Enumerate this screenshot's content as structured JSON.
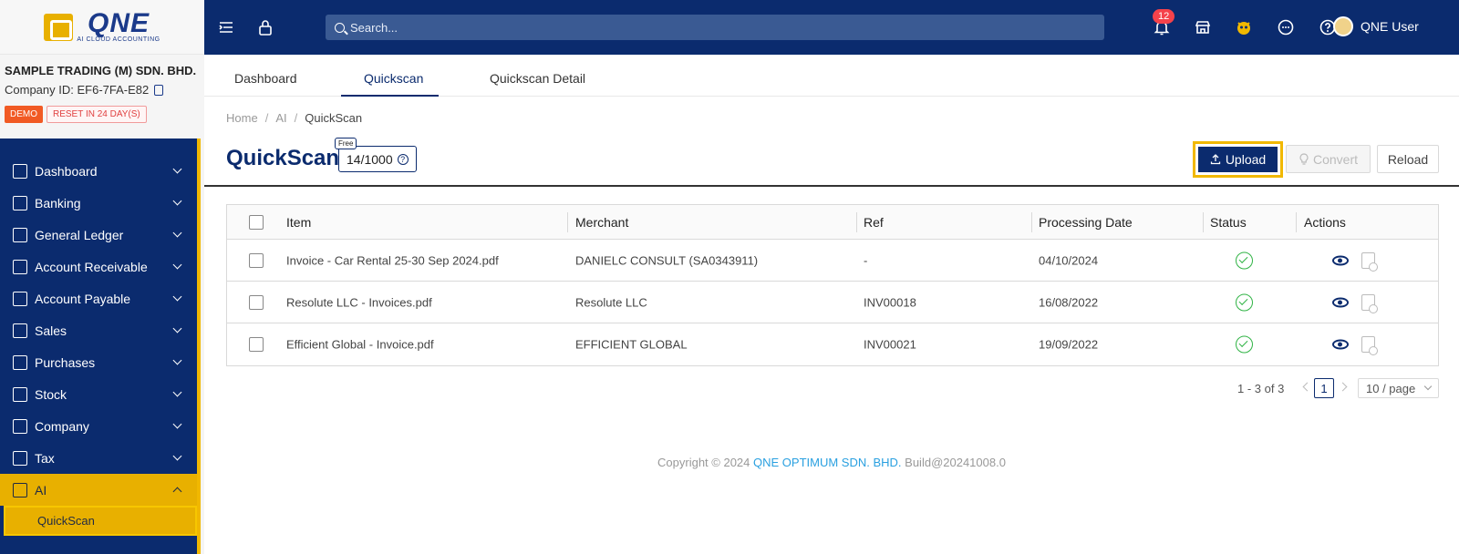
{
  "brand": {
    "logo_text": "QNE",
    "logo_sub": "AI CLOUD ACCOUNTING"
  },
  "company": {
    "name": "SAMPLE TRADING (M) SDN. BHD.",
    "id_label": "Company ID: EF6-7FA-E82",
    "demo_badge": "DEMO",
    "reset_badge": "RESET IN 24 DAY(S)"
  },
  "sidebar": {
    "items": [
      {
        "label": "Dashboard",
        "icon": "dashboard-icon"
      },
      {
        "label": "Banking",
        "icon": "bank-icon"
      },
      {
        "label": "General Ledger",
        "icon": "ledger-icon"
      },
      {
        "label": "Account Receivable",
        "icon": "receivable-icon"
      },
      {
        "label": "Account Payable",
        "icon": "payable-icon"
      },
      {
        "label": "Sales",
        "icon": "cart-icon"
      },
      {
        "label": "Purchases",
        "icon": "purchases-icon"
      },
      {
        "label": "Stock",
        "icon": "box-icon"
      },
      {
        "label": "Company",
        "icon": "building-icon"
      },
      {
        "label": "Tax",
        "icon": "tax-icon"
      },
      {
        "label": "AI",
        "icon": "robot-icon"
      }
    ],
    "sub_item": "QuickScan"
  },
  "topbar": {
    "search_placeholder": "Search...",
    "notification_count": "12",
    "user_name": "QNE User"
  },
  "tabs": [
    "Dashboard",
    "Quickscan",
    "Quickscan Detail"
  ],
  "breadcrumb": [
    "Home",
    "AI",
    "QuickScan"
  ],
  "page": {
    "title": "QuickScan",
    "free_tag": "Free",
    "quota": "14/1000",
    "upload_label": "Upload",
    "convert_label": "Convert",
    "reload_label": "Reload"
  },
  "table": {
    "columns": [
      "Item",
      "Merchant",
      "Ref",
      "Processing Date",
      "Status",
      "Actions"
    ],
    "rows": [
      {
        "item": "Invoice - Car Rental 25-30 Sep 2024.pdf",
        "merchant": "DANIELC CONSULT (SA0343911)",
        "ref": "-",
        "date": "04/10/2024"
      },
      {
        "item": "Resolute LLC - Invoices.pdf",
        "merchant": "Resolute LLC",
        "ref": "INV00018",
        "date": "16/08/2022"
      },
      {
        "item": "Efficient Global - Invoice.pdf",
        "merchant": "EFFICIENT GLOBAL",
        "ref": "INV00021",
        "date": "19/09/2022"
      }
    ]
  },
  "pagination": {
    "total": "1 - 3 of 3",
    "current": "1",
    "page_size": "10 / page"
  },
  "footer": {
    "copyright": "Copyright © 2024",
    "company": "QNE OPTIMUM SDN. BHD.",
    "build": "Build@20241008.0"
  },
  "colors": {
    "primary": "#0b2b6e",
    "accent": "#e8b000",
    "success": "#2fb344"
  }
}
